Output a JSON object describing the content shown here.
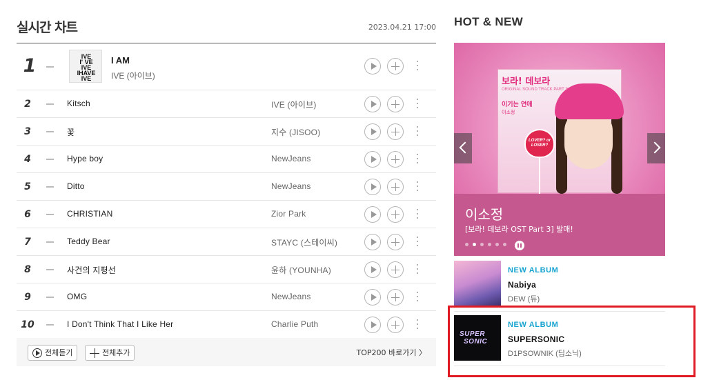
{
  "chart": {
    "title": "실시간 차트",
    "timestamp": "2023.04.21  17:00",
    "first": {
      "rank": "1",
      "title": "I AM",
      "artist": "IVE (아이브)",
      "art_lines": [
        "IVE",
        "I' VE",
        "IVE",
        "IHAVE",
        "IVE"
      ]
    },
    "rows": [
      {
        "rank": "2",
        "title": "Kitsch",
        "artist": "IVE (아이브)"
      },
      {
        "rank": "3",
        "title": "꽃",
        "artist": "지수 (JISOO)"
      },
      {
        "rank": "4",
        "title": "Hype boy",
        "artist": "NewJeans"
      },
      {
        "rank": "5",
        "title": "Ditto",
        "artist": "NewJeans"
      },
      {
        "rank": "6",
        "title": "CHRISTIAN",
        "artist": "Zior Park"
      },
      {
        "rank": "7",
        "title": "Teddy Bear",
        "artist": "STAYC (스테이씨)"
      },
      {
        "rank": "8",
        "title": "사건의 지평선",
        "artist": "윤하 (YOUNHA)"
      },
      {
        "rank": "9",
        "title": "OMG",
        "artist": "NewJeans"
      },
      {
        "rank": "10",
        "title": "I Don't Think That I Like Her",
        "artist": "Charlie Puth"
      }
    ],
    "footer": {
      "listen_all": "전체듣기",
      "add_all": "전체추가",
      "top200": "TOP200 바로가기 〉"
    }
  },
  "hot": {
    "title": "HOT & NEW",
    "banner": {
      "card_head": "보라! 데보라",
      "card_sub": "ORIGINAL SOUND TRACK PART 3",
      "card_song": "이기는 연애",
      "card_artist": "이소정",
      "lollipop_text": "LOVER? or LOSER?",
      "artist": "이소정",
      "description": "[보라! 데보라 OST Part 3] 발매!",
      "dot_count": 6,
      "active_dot": 1
    },
    "albums": [
      {
        "tag": "NEW ALBUM",
        "title": "Nabiya",
        "artist": "DEW (듀)",
        "art": "nabiya-cover"
      },
      {
        "tag": "NEW ALBUM",
        "title": "SUPERSONIC",
        "artist": "D1PSOWNIK (딥소닉)",
        "art_text": [
          "SUPER",
          "SONIC"
        ]
      }
    ]
  },
  "colors": {
    "accent_new": "#16a3cf",
    "banner_bg": "#c4588f",
    "highlight": "#e01b24"
  }
}
